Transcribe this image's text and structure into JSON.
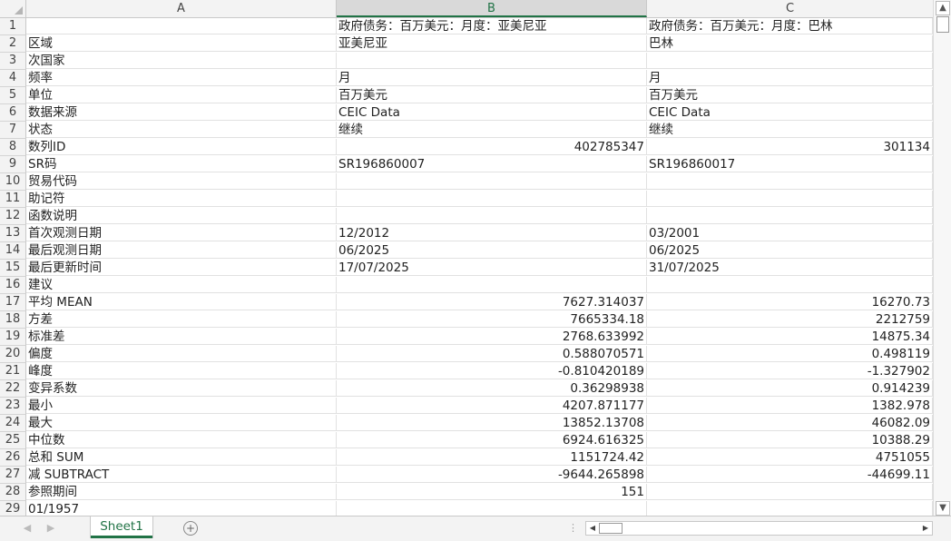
{
  "columns": [
    "A",
    "B",
    "C"
  ],
  "selected_column": "B",
  "rows": [
    {
      "n": "1",
      "a": "",
      "b": "政府债务：百万美元：月度：亚美尼亚",
      "c": "政府债务：百万美元：月度：巴林"
    },
    {
      "n": "2",
      "a": "区域",
      "b": "亚美尼亚",
      "c": "巴林"
    },
    {
      "n": "3",
      "a": "次国家",
      "b": "",
      "c": ""
    },
    {
      "n": "4",
      "a": "频率",
      "b": "月",
      "c": "月"
    },
    {
      "n": "5",
      "a": "单位",
      "b": "百万美元",
      "c": "百万美元"
    },
    {
      "n": "6",
      "a": "数据来源",
      "b": "CEIC Data",
      "c": "CEIC Data"
    },
    {
      "n": "7",
      "a": "状态",
      "b": "继续",
      "c": "继续"
    },
    {
      "n": "8",
      "a": "数列ID",
      "b": "402785347",
      "c": "301134",
      "num": true
    },
    {
      "n": "9",
      "a": "SR码",
      "b": "SR196860007",
      "c": "SR196860017"
    },
    {
      "n": "10",
      "a": "贸易代码",
      "b": "",
      "c": ""
    },
    {
      "n": "11",
      "a": "助记符",
      "b": "",
      "c": ""
    },
    {
      "n": "12",
      "a": "函数说明",
      "b": "",
      "c": ""
    },
    {
      "n": "13",
      "a": "首次观测日期",
      "b": "12/2012",
      "c": "03/2001"
    },
    {
      "n": "14",
      "a": "最后观测日期",
      "b": "06/2025",
      "c": "06/2025"
    },
    {
      "n": "15",
      "a": "最后更新时间",
      "b": "17/07/2025",
      "c": "31/07/2025"
    },
    {
      "n": "16",
      "a": "建议",
      "b": "",
      "c": ""
    },
    {
      "n": "17",
      "a": "平均 MEAN",
      "b": "7627.314037",
      "c": "16270.73",
      "num": true
    },
    {
      "n": "18",
      "a": "方差",
      "b": "7665334.18",
      "c": "2212759",
      "num": true
    },
    {
      "n": "19",
      "a": "标准差",
      "b": "2768.633992",
      "c": "14875.34",
      "num": true
    },
    {
      "n": "20",
      "a": "偏度",
      "b": "0.588070571",
      "c": "0.498119",
      "num": true
    },
    {
      "n": "21",
      "a": "峰度",
      "b": "-0.810420189",
      "c": "-1.327902",
      "num": true
    },
    {
      "n": "22",
      "a": "变异系数",
      "b": "0.36298938",
      "c": "0.914239",
      "num": true
    },
    {
      "n": "23",
      "a": "最小",
      "b": "4207.871177",
      "c": "1382.978",
      "num": true
    },
    {
      "n": "24",
      "a": "最大",
      "b": "13852.13708",
      "c": "46082.09",
      "num": true
    },
    {
      "n": "25",
      "a": "中位数",
      "b": "6924.616325",
      "c": "10388.29",
      "num": true
    },
    {
      "n": "26",
      "a": "总和 SUM",
      "b": "1151724.42",
      "c": "4751055",
      "num": true
    },
    {
      "n": "27",
      "a": "减 SUBTRACT",
      "b": "-9644.265898",
      "c": "-44699.11",
      "num": true
    },
    {
      "n": "28",
      "a": "参照期间",
      "b": "151",
      "c": "",
      "num": true
    },
    {
      "n": "29",
      "a": "01/1957",
      "b": "",
      "c": ""
    }
  ],
  "sheet_tab": "Sheet1",
  "add_sheet": "+",
  "colors": {
    "accent": "#217346",
    "header_bg": "#f3f3f3",
    "grid": "#e1e1e1"
  }
}
